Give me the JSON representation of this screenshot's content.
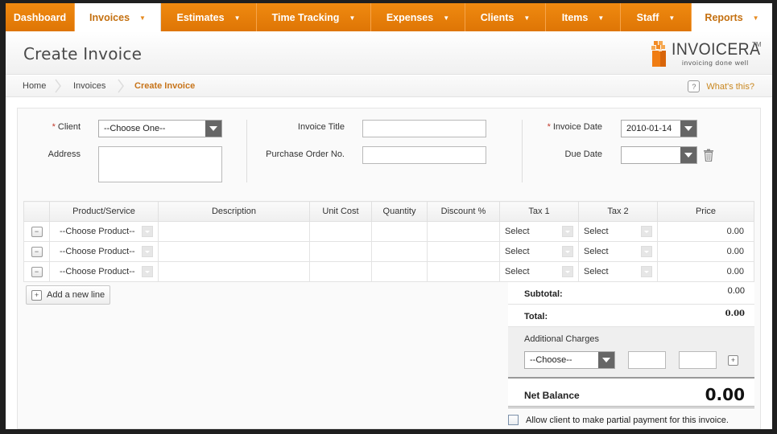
{
  "nav": {
    "items": [
      {
        "label": "Dashboard",
        "has_caret": false,
        "active": false
      },
      {
        "label": "Invoices",
        "has_caret": true,
        "active": true
      },
      {
        "label": "Estimates",
        "has_caret": true,
        "active": false
      },
      {
        "label": "Time Tracking",
        "has_caret": true,
        "active": false
      },
      {
        "label": "Expenses",
        "has_caret": true,
        "active": false
      },
      {
        "label": "Clients",
        "has_caret": true,
        "active": false
      },
      {
        "label": "Items",
        "has_caret": true,
        "active": false
      },
      {
        "label": "Staff",
        "has_caret": true,
        "active": false
      },
      {
        "label": "Reports",
        "has_caret": true,
        "active": true
      }
    ],
    "caret_glyph": "▼"
  },
  "header": {
    "title": "Create Invoice",
    "logo": {
      "word": "INVOICERA",
      "tm": "TM",
      "tagline": "invoicing done well"
    }
  },
  "breadcrumb": {
    "items": [
      "Home",
      "Invoices",
      "Create Invoice"
    ],
    "help_label": "What's this?",
    "help_icon": "?"
  },
  "form": {
    "client": {
      "label": "Client",
      "required": "*",
      "value": "--Choose One--"
    },
    "address": {
      "label": "Address",
      "value": ""
    },
    "invoice_title": {
      "label": "Invoice Title",
      "value": ""
    },
    "po_number": {
      "label": "Purchase Order No.",
      "value": ""
    },
    "invoice_date": {
      "label": "Invoice Date",
      "required": "*",
      "value": "2010-01-14"
    },
    "due_date": {
      "label": "Due Date",
      "value": ""
    }
  },
  "lines": {
    "columns": [
      "",
      "Product/Service",
      "Description",
      "Unit Cost",
      "Quantity",
      "Discount %",
      "Tax 1",
      "Tax 2",
      "Price"
    ],
    "rows": [
      {
        "product": "--Choose Product--",
        "description": "",
        "unit_cost": "",
        "quantity": "",
        "discount": "",
        "tax1": "Select",
        "tax2": "Select",
        "price": "0.00"
      },
      {
        "product": "--Choose Product--",
        "description": "",
        "unit_cost": "",
        "quantity": "",
        "discount": "",
        "tax1": "Select",
        "tax2": "Select",
        "price": "0.00"
      },
      {
        "product": "--Choose Product--",
        "description": "",
        "unit_cost": "",
        "quantity": "",
        "discount": "",
        "tax1": "Select",
        "tax2": "Select",
        "price": "0.00"
      }
    ],
    "remove_glyph": "−",
    "add_line_label": "Add a new line",
    "add_glyph": "+"
  },
  "totals": {
    "subtotal_label": "Subtotal:",
    "subtotal_value": "0.00",
    "total_label": "Total:",
    "total_value": "0.00",
    "additional_charges_label": "Additional Charges",
    "charge_select": "--Choose--",
    "charge_value_1": "",
    "charge_value_2": "",
    "add_charge_glyph": "+",
    "net_balance_label": "Net Balance",
    "net_balance_value": "0.00"
  },
  "partial_payment": {
    "label": "Allow client to make partial payment for this invoice.",
    "checked": false
  },
  "colors": {
    "nav_orange": "#e37b07",
    "accent_text": "#c7741a",
    "required": "#c0392b"
  }
}
